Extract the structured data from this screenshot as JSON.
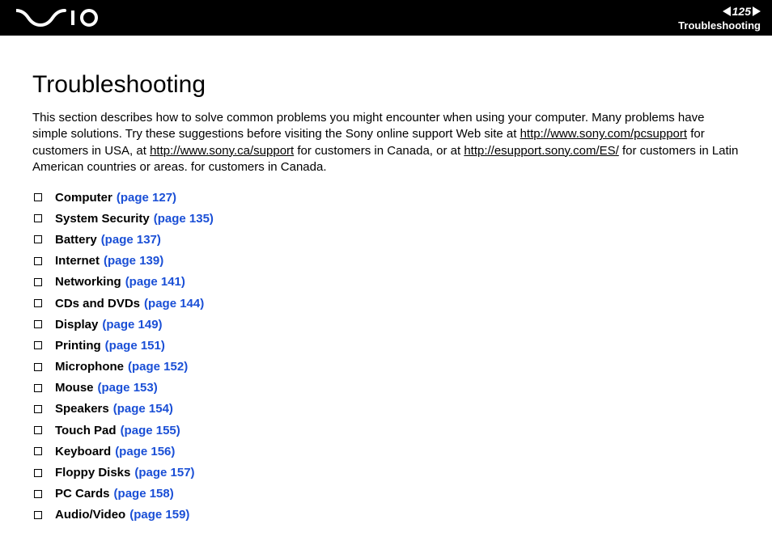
{
  "header": {
    "page_number": "125",
    "section_label": "Troubleshooting"
  },
  "title": "Troubleshooting",
  "intro": {
    "t1": "This section describes how to solve common problems you might encounter when using your computer. Many problems have simple solutions. Try these suggestions before visiting the Sony online support Web site at ",
    "link1": "http://www.sony.com/pcsupport",
    "t2": " for customers in USA, at ",
    "link2": "http://www.sony.ca/support",
    "t3": " for customers in Canada, or at ",
    "link3": "http://esupport.sony.com/ES/",
    "t4": " for customers in Latin American countries or areas. for customers in Canada."
  },
  "toc": [
    {
      "label": "Computer",
      "page": "(page 127)"
    },
    {
      "label": "System Security",
      "page": "(page 135)"
    },
    {
      "label": "Battery",
      "page": "(page 137)"
    },
    {
      "label": "Internet",
      "page": "(page 139)"
    },
    {
      "label": "Networking",
      "page": "(page 141)"
    },
    {
      "label": "CDs and DVDs",
      "page": "(page 144)"
    },
    {
      "label": "Display",
      "page": "(page 149)"
    },
    {
      "label": "Printing",
      "page": "(page 151)"
    },
    {
      "label": "Microphone",
      "page": "(page 152)"
    },
    {
      "label": "Mouse",
      "page": "(page 153)"
    },
    {
      "label": "Speakers",
      "page": "(page 154)"
    },
    {
      "label": "Touch Pad",
      "page": "(page 155)"
    },
    {
      "label": "Keyboard",
      "page": "(page 156)"
    },
    {
      "label": "Floppy Disks",
      "page": "(page 157)"
    },
    {
      "label": "PC Cards",
      "page": "(page 158)"
    },
    {
      "label": "Audio/Video",
      "page": "(page 159)"
    }
  ]
}
